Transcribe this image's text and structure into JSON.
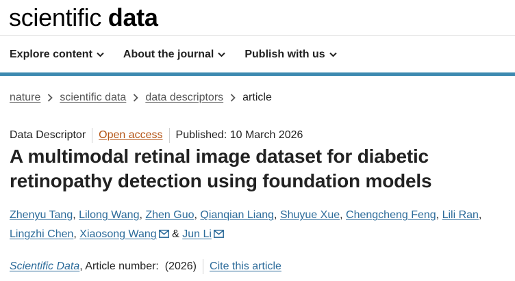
{
  "brand": {
    "light": "scientific",
    "bold": "data"
  },
  "nav": {
    "items": [
      {
        "label": "Explore content"
      },
      {
        "label": "About the journal"
      },
      {
        "label": "Publish with us"
      }
    ]
  },
  "breadcrumb": {
    "items": [
      "nature",
      "scientific data",
      "data descriptors"
    ],
    "current": "article"
  },
  "article": {
    "type": "Data Descriptor",
    "access": "Open access",
    "published": "Published: 10 March 2026",
    "title": "A multimodal retinal image dataset for diabetic retinopathy detection using foundation models",
    "authors": [
      "Zhenyu Tang",
      "Lilong Wang",
      "Zhen Guo",
      "Qianqian Liang",
      "Shuyue Xue",
      "Chengcheng Feng",
      "Lili Ran",
      "Lingzhi Chen",
      "Xiaosong Wang",
      "Jun Li"
    ],
    "author_separator": ", ",
    "author_final_separator": " & ",
    "journal": "Scientific Data",
    "article_number_text": ", Article number:  (2026)",
    "cite_label": "Cite this article"
  },
  "colors": {
    "accent_bar": "#3d8ab0",
    "link": "#2c6b9a",
    "open_access": "#b45414"
  },
  "icons": {
    "nav_chevron": "chevron-down-icon",
    "breadcrumb_sep": "chevron-right-icon",
    "email": "mail-icon"
  }
}
